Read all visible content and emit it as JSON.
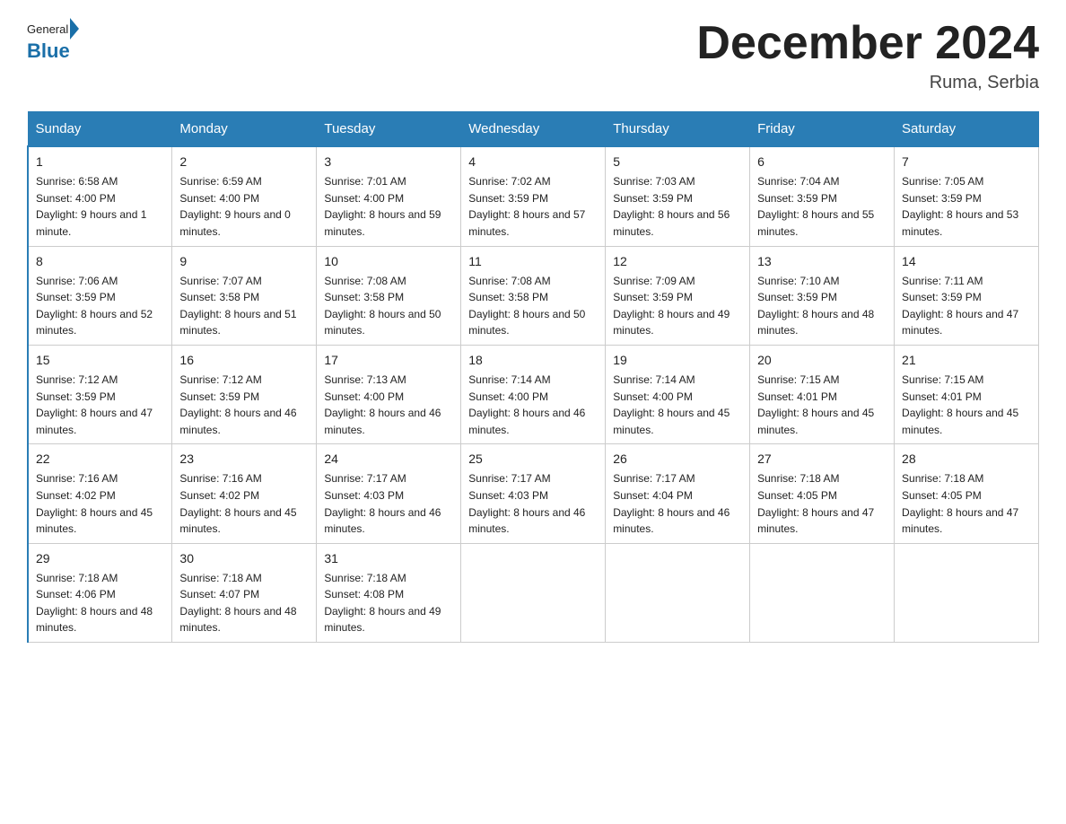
{
  "header": {
    "logo_general": "General",
    "logo_blue": "Blue",
    "title": "December 2024",
    "location": "Ruma, Serbia"
  },
  "days_of_week": [
    "Sunday",
    "Monday",
    "Tuesday",
    "Wednesday",
    "Thursday",
    "Friday",
    "Saturday"
  ],
  "weeks": [
    [
      {
        "day": "1",
        "sunrise": "6:58 AM",
        "sunset": "4:00 PM",
        "daylight": "9 hours and 1 minute."
      },
      {
        "day": "2",
        "sunrise": "6:59 AM",
        "sunset": "4:00 PM",
        "daylight": "9 hours and 0 minutes."
      },
      {
        "day": "3",
        "sunrise": "7:01 AM",
        "sunset": "4:00 PM",
        "daylight": "8 hours and 59 minutes."
      },
      {
        "day": "4",
        "sunrise": "7:02 AM",
        "sunset": "3:59 PM",
        "daylight": "8 hours and 57 minutes."
      },
      {
        "day": "5",
        "sunrise": "7:03 AM",
        "sunset": "3:59 PM",
        "daylight": "8 hours and 56 minutes."
      },
      {
        "day": "6",
        "sunrise": "7:04 AM",
        "sunset": "3:59 PM",
        "daylight": "8 hours and 55 minutes."
      },
      {
        "day": "7",
        "sunrise": "7:05 AM",
        "sunset": "3:59 PM",
        "daylight": "8 hours and 53 minutes."
      }
    ],
    [
      {
        "day": "8",
        "sunrise": "7:06 AM",
        "sunset": "3:59 PM",
        "daylight": "8 hours and 52 minutes."
      },
      {
        "day": "9",
        "sunrise": "7:07 AM",
        "sunset": "3:58 PM",
        "daylight": "8 hours and 51 minutes."
      },
      {
        "day": "10",
        "sunrise": "7:08 AM",
        "sunset": "3:58 PM",
        "daylight": "8 hours and 50 minutes."
      },
      {
        "day": "11",
        "sunrise": "7:08 AM",
        "sunset": "3:58 PM",
        "daylight": "8 hours and 50 minutes."
      },
      {
        "day": "12",
        "sunrise": "7:09 AM",
        "sunset": "3:59 PM",
        "daylight": "8 hours and 49 minutes."
      },
      {
        "day": "13",
        "sunrise": "7:10 AM",
        "sunset": "3:59 PM",
        "daylight": "8 hours and 48 minutes."
      },
      {
        "day": "14",
        "sunrise": "7:11 AM",
        "sunset": "3:59 PM",
        "daylight": "8 hours and 47 minutes."
      }
    ],
    [
      {
        "day": "15",
        "sunrise": "7:12 AM",
        "sunset": "3:59 PM",
        "daylight": "8 hours and 47 minutes."
      },
      {
        "day": "16",
        "sunrise": "7:12 AM",
        "sunset": "3:59 PM",
        "daylight": "8 hours and 46 minutes."
      },
      {
        "day": "17",
        "sunrise": "7:13 AM",
        "sunset": "4:00 PM",
        "daylight": "8 hours and 46 minutes."
      },
      {
        "day": "18",
        "sunrise": "7:14 AM",
        "sunset": "4:00 PM",
        "daylight": "8 hours and 46 minutes."
      },
      {
        "day": "19",
        "sunrise": "7:14 AM",
        "sunset": "4:00 PM",
        "daylight": "8 hours and 45 minutes."
      },
      {
        "day": "20",
        "sunrise": "7:15 AM",
        "sunset": "4:01 PM",
        "daylight": "8 hours and 45 minutes."
      },
      {
        "day": "21",
        "sunrise": "7:15 AM",
        "sunset": "4:01 PM",
        "daylight": "8 hours and 45 minutes."
      }
    ],
    [
      {
        "day": "22",
        "sunrise": "7:16 AM",
        "sunset": "4:02 PM",
        "daylight": "8 hours and 45 minutes."
      },
      {
        "day": "23",
        "sunrise": "7:16 AM",
        "sunset": "4:02 PM",
        "daylight": "8 hours and 45 minutes."
      },
      {
        "day": "24",
        "sunrise": "7:17 AM",
        "sunset": "4:03 PM",
        "daylight": "8 hours and 46 minutes."
      },
      {
        "day": "25",
        "sunrise": "7:17 AM",
        "sunset": "4:03 PM",
        "daylight": "8 hours and 46 minutes."
      },
      {
        "day": "26",
        "sunrise": "7:17 AM",
        "sunset": "4:04 PM",
        "daylight": "8 hours and 46 minutes."
      },
      {
        "day": "27",
        "sunrise": "7:18 AM",
        "sunset": "4:05 PM",
        "daylight": "8 hours and 47 minutes."
      },
      {
        "day": "28",
        "sunrise": "7:18 AM",
        "sunset": "4:05 PM",
        "daylight": "8 hours and 47 minutes."
      }
    ],
    [
      {
        "day": "29",
        "sunrise": "7:18 AM",
        "sunset": "4:06 PM",
        "daylight": "8 hours and 48 minutes."
      },
      {
        "day": "30",
        "sunrise": "7:18 AM",
        "sunset": "4:07 PM",
        "daylight": "8 hours and 48 minutes."
      },
      {
        "day": "31",
        "sunrise": "7:18 AM",
        "sunset": "4:08 PM",
        "daylight": "8 hours and 49 minutes."
      },
      null,
      null,
      null,
      null
    ]
  ],
  "labels": {
    "sunrise_prefix": "Sunrise: ",
    "sunset_prefix": "Sunset: ",
    "daylight_prefix": "Daylight: "
  }
}
